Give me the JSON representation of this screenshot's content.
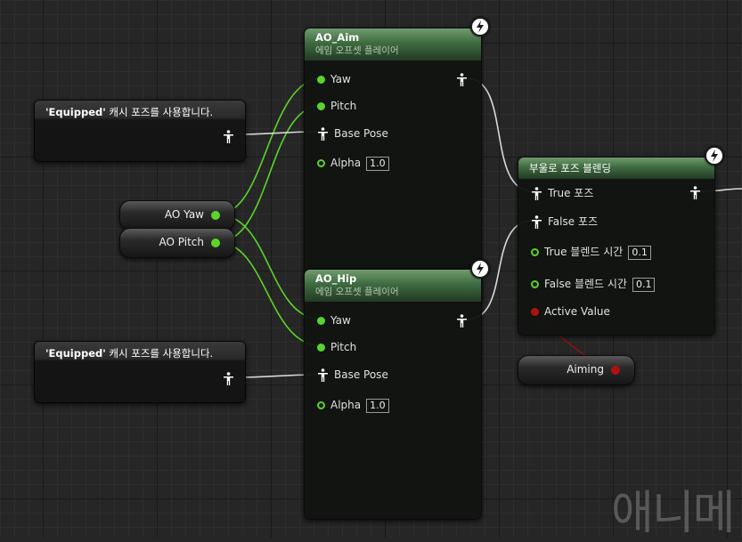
{
  "colors": {
    "exec_pin": "#5ad42a",
    "bool_pin": "#b01010",
    "node_header": "#3f6b40"
  },
  "nodes": {
    "ao_aim": {
      "title": "AO_Aim",
      "subtitle": "에임 오프셋 플레이어",
      "pins": {
        "yaw": "Yaw",
        "pitch": "Pitch",
        "base_pose": "Base Pose",
        "alpha": "Alpha",
        "alpha_value": "1.0"
      }
    },
    "ao_hip": {
      "title": "AO_Hip",
      "subtitle": "에임 오프셋 플레이어",
      "pins": {
        "yaw": "Yaw",
        "pitch": "Pitch",
        "base_pose": "Base Pose",
        "alpha": "Alpha",
        "alpha_value": "1.0"
      }
    },
    "blend": {
      "title": "부울로 포즈 블렌딩",
      "pins": {
        "true_pose": "True 포즈",
        "false_pose": "False 포즈",
        "true_blend": "True 블렌드 시간",
        "true_blend_value": "0.1",
        "false_blend": "False 블렌드 시간",
        "false_blend_value": "0.1",
        "active_value": "Active Value"
      }
    },
    "cache_top": {
      "name": "'Equipped'",
      "suffix": " 캐시 포즈를 사용합니다."
    },
    "cache_bottom": {
      "name": "'Equipped'",
      "suffix": " 캐시 포즈를 사용합니다."
    },
    "var_ao_yaw": {
      "label": "AO Yaw"
    },
    "var_ao_pitch": {
      "label": "AO Pitch"
    },
    "var_aiming": {
      "label": "Aiming"
    }
  },
  "watermark": "애니메"
}
